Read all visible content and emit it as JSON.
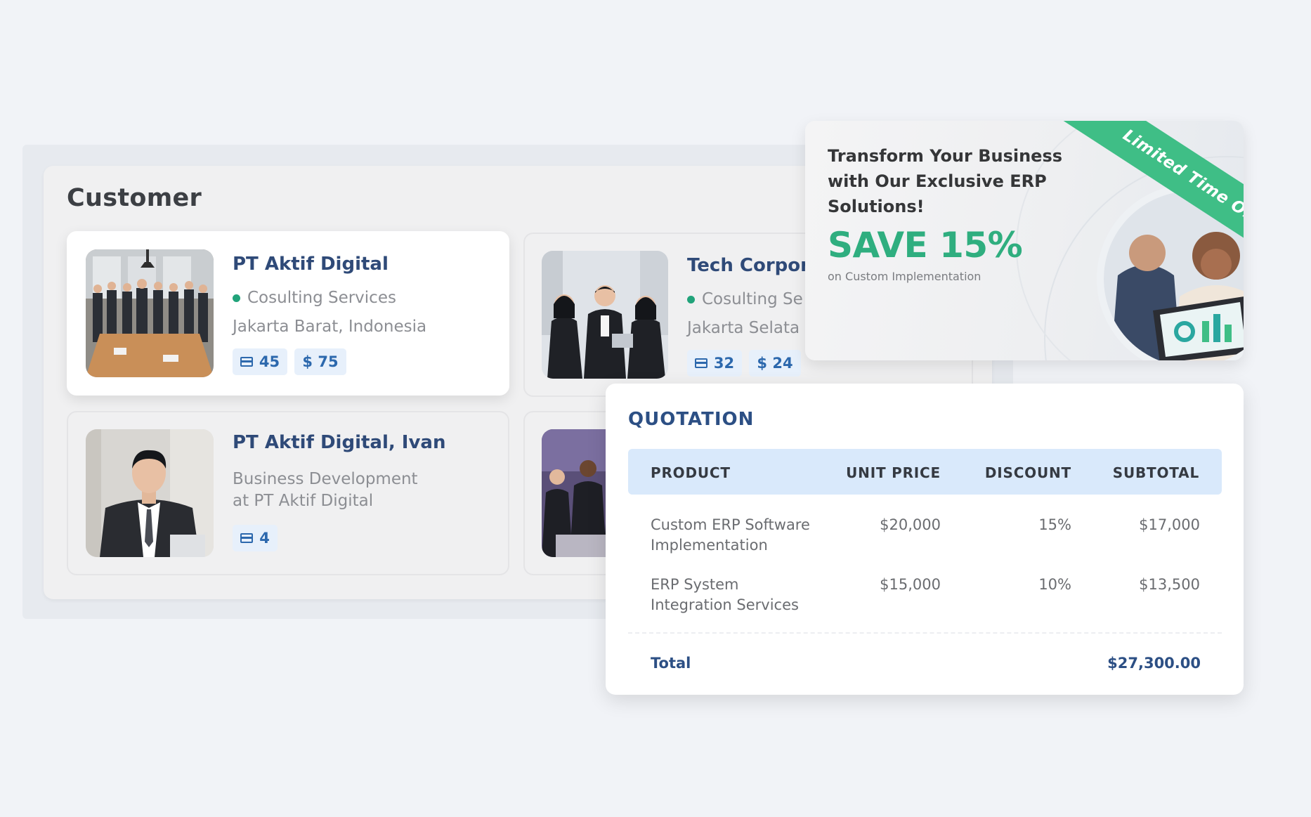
{
  "customer": {
    "title": "Customer",
    "cards": [
      {
        "name": "PT Aktif Digital",
        "service": "Cosulting Services",
        "location": "Jakarta Barat, Indonesia",
        "badge_count": "45",
        "badge_amount": "$ 75"
      },
      {
        "name": "Tech Corpora",
        "service": "Cosulting Se",
        "location": "Jakarta Selata",
        "badge_count": "32",
        "badge_amount": "$ 24"
      },
      {
        "name": "PT Aktif Digital, Ivan",
        "subtitle_line1": "Business Development",
        "subtitle_line2": "at PT Aktif Digital",
        "badge_count": "4"
      }
    ]
  },
  "promo": {
    "title": "Transform Your Business with Our Exclusive ERP Solutions!",
    "save": "SAVE 15%",
    "subtitle": "on Custom Implementation",
    "ribbon": "Limited Time Offer!"
  },
  "quotation": {
    "title": "QUOTATION",
    "headers": {
      "product": "PRODUCT",
      "unit_price": "UNIT PRICE",
      "discount": "DISCOUNT",
      "subtotal": "SUBTOTAL"
    },
    "rows": [
      {
        "product_line1": "Custom ERP Software",
        "product_line2": "Implementation",
        "unit_price": "$20,000",
        "discount": "15%",
        "subtotal": "$17,000"
      },
      {
        "product_line1": "ERP System",
        "product_line2": "Integration Services",
        "unit_price": "$15,000",
        "discount": "10%",
        "subtotal": "$13,500"
      }
    ],
    "total_label": "Total",
    "total_value": "$27,300.00"
  },
  "colors": {
    "accent_green": "#2fae7f",
    "navy": "#2c4f84",
    "badge_blue": "#2c68ad",
    "header_blue": "#d9e9fb"
  }
}
